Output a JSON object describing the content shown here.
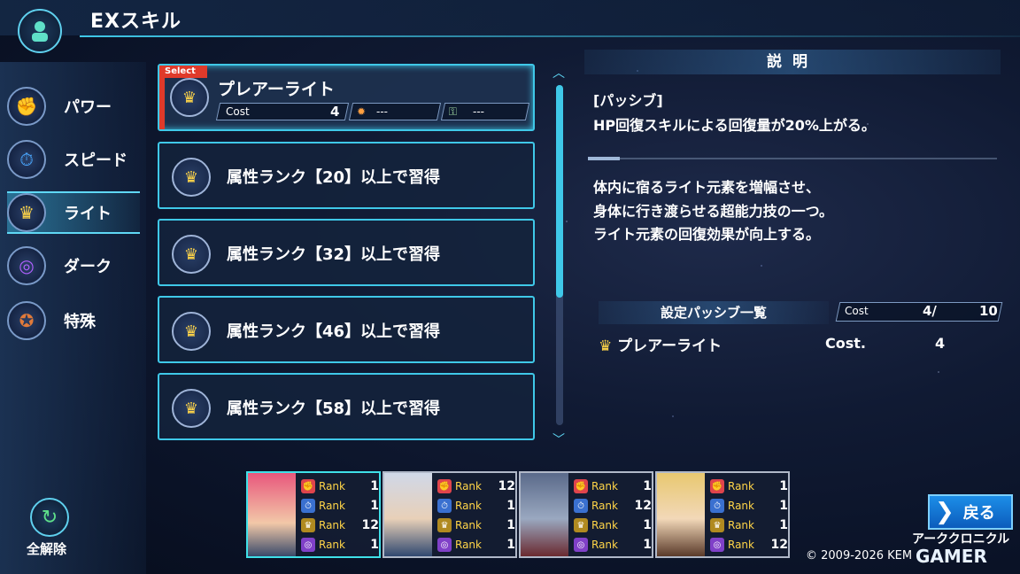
{
  "header": {
    "title": "EXスキル",
    "icon": "character-icon"
  },
  "categories": [
    {
      "label": "パワー",
      "icon": "muscle-icon",
      "color": "#e0444c"
    },
    {
      "label": "スピード",
      "icon": "speed-icon",
      "color": "#4aa8ff"
    },
    {
      "label": "ライト",
      "icon": "crown-icon",
      "color": "#ffd548",
      "active": true
    },
    {
      "label": "ダーク",
      "icon": "vortex-icon",
      "color": "#b060ff"
    },
    {
      "label": "特殊",
      "icon": "special-icon",
      "color": "#e07a3a"
    }
  ],
  "reset": {
    "label": "全解除"
  },
  "skills": {
    "selected_tag": "Select",
    "selected_name": "プレアーライト",
    "cost_label": "Cost",
    "cost_value": "4",
    "slot2": "---",
    "slot3": "---",
    "locked": [
      "属性ランク【20】以上で習得",
      "属性ランク【32】以上で習得",
      "属性ランク【46】以上で習得",
      "属性ランク【58】以上で習得"
    ]
  },
  "description": {
    "header": "説明",
    "type": "[パッシブ]",
    "effect": "HP回復スキルによる回復量が20%上がる。",
    "flavor": [
      "体内に宿るライト元素を増幅させ、",
      "身体に行き渡らせる超能力技の一つ。",
      "ライト元素の回復効果が向上する。"
    ],
    "passive_list_header": "設定パッシブ一覧",
    "passive_cost_label": "Cost",
    "passive_cost_used": "4/",
    "passive_cost_max": "10",
    "passive_item": "プレアーライト",
    "passive_item_cost_label": "Cost.",
    "passive_item_cost": "4"
  },
  "party": [
    {
      "ranks": [
        "1",
        "1",
        "12",
        "1"
      ],
      "hair": "#e8577c"
    },
    {
      "ranks": [
        "12",
        "1",
        "1",
        "1"
      ],
      "hair": "#d0d8e8"
    },
    {
      "ranks": [
        "1",
        "12",
        "1",
        "1"
      ],
      "hair": "#5a6a8a"
    },
    {
      "ranks": [
        "1",
        "1",
        "1",
        "12"
      ],
      "hair": "#e8c870"
    }
  ],
  "rank_label": "Rank",
  "footer": {
    "back_label": "戻る",
    "sub_label": "アーククロニクル",
    "copyright": "© 2009-2026 KEM",
    "watermark": "GAMER"
  }
}
